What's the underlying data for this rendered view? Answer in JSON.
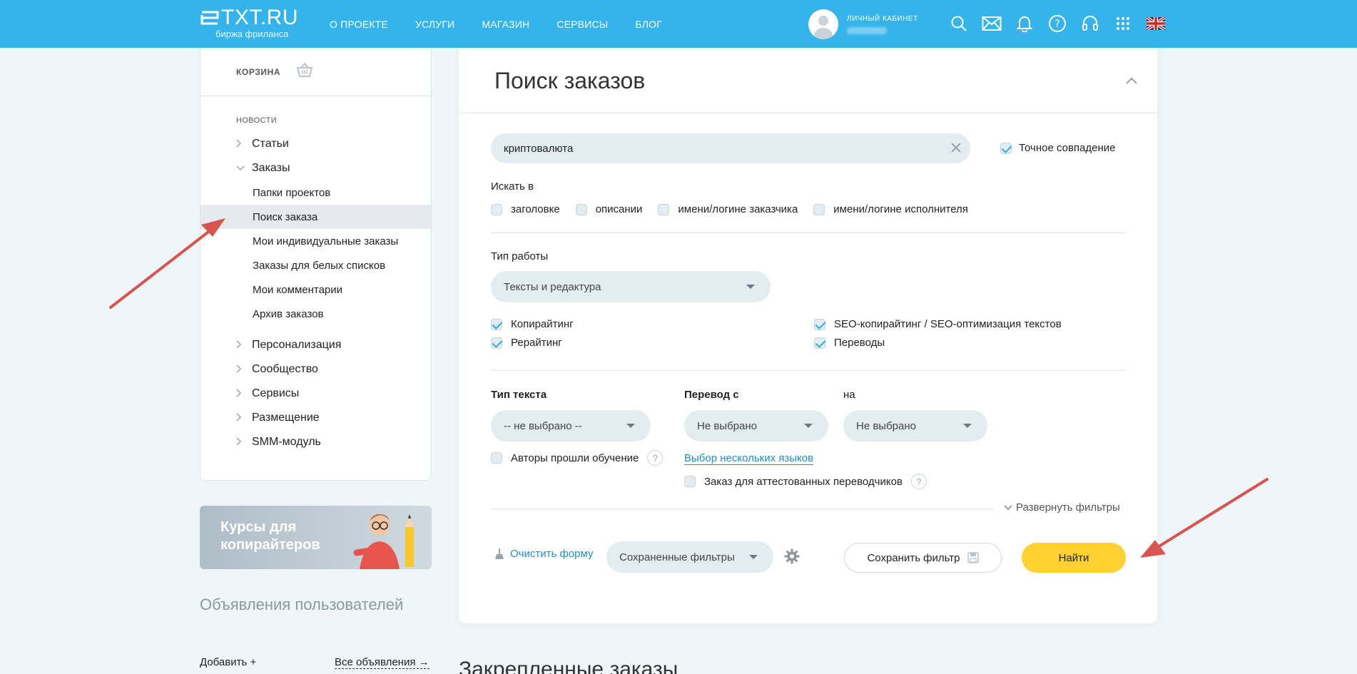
{
  "header": {
    "logo_text": "TXT.RU",
    "logo_sub": "биржа фриланса",
    "nav": [
      "О ПРОЕКТЕ",
      "УСЛУГИ",
      "МАГАЗИН",
      "СЕРВИСЫ",
      "БЛОГ"
    ],
    "account_label": "ЛИЧНЫЙ КАБИНЕТ",
    "icons": [
      "search-icon",
      "mail-icon",
      "bell-icon",
      "help-icon",
      "support-headset-icon",
      "apps-grid-icon",
      "uk-flag-icon"
    ]
  },
  "sidebar": {
    "cart_label": "КОРЗИНА",
    "news_label": "НОВОСТИ",
    "items": [
      {
        "label": "Статьи",
        "chevron": "›"
      },
      {
        "label": "Заказы",
        "chevron": "⌄"
      }
    ],
    "sub_items": [
      "Папки проектов",
      "Поиск заказа",
      "Мои индивидуальные заказы",
      "Заказы для белых списков",
      "Мои комментарии",
      "Архив заказов"
    ],
    "more_items": [
      "Персонализация",
      "Сообщество",
      "Сервисы",
      "Размещение",
      "SMM-модуль"
    ],
    "active_sub": "Поиск заказа"
  },
  "promo": {
    "line1": "Курсы для",
    "line2": "копирайтеров"
  },
  "announcements": {
    "title": "Объявления пользователей",
    "add": "Добавить +",
    "all": "Все объявления →"
  },
  "main": {
    "title": "Поиск заказов",
    "search_value": "криптовалюта",
    "exact_match": "Точное совпадение",
    "search_in_label": "Искать в",
    "search_in_options": [
      "заголовке",
      "описании",
      "имени/логине заказчика",
      "имени/логине исполнителя"
    ],
    "work_type_label": "Тип работы",
    "work_type_value": "Тексты и редактура",
    "work_checkboxes": [
      {
        "label": "Копирайтинг",
        "checked": true
      },
      {
        "label": "SEO-копирайтинг / SEO-оптимизация текстов",
        "checked": true
      },
      {
        "label": "Рерайтинг",
        "checked": true
      },
      {
        "label": "Переводы",
        "checked": true
      }
    ],
    "text_type_label": "Тип текста",
    "text_type_value": "-- не выбрано --",
    "translate_from_label": "Перевод с",
    "translate_from_value": "Не выбрано",
    "translate_to_label": "на",
    "translate_to_value": "Не выбрано",
    "authors_trained": "Авторы прошли обучение",
    "multi_lang_link": "Выбор нескольких языков",
    "certified_translators": "Заказ для аттестованных переводчиков",
    "qmark": "?",
    "expand_filters": "Развернуть фильтры",
    "clear_form": "Очистить форму",
    "saved_filters": "Сохраненные фильтры",
    "save_filter": "Сохранить фильтр",
    "find": "Найти"
  },
  "pinned_title": "Закрепленные заказы",
  "colors": {
    "accent": "#34b4ea",
    "find_button": "#fcd130",
    "arrow": "#d9534f"
  }
}
